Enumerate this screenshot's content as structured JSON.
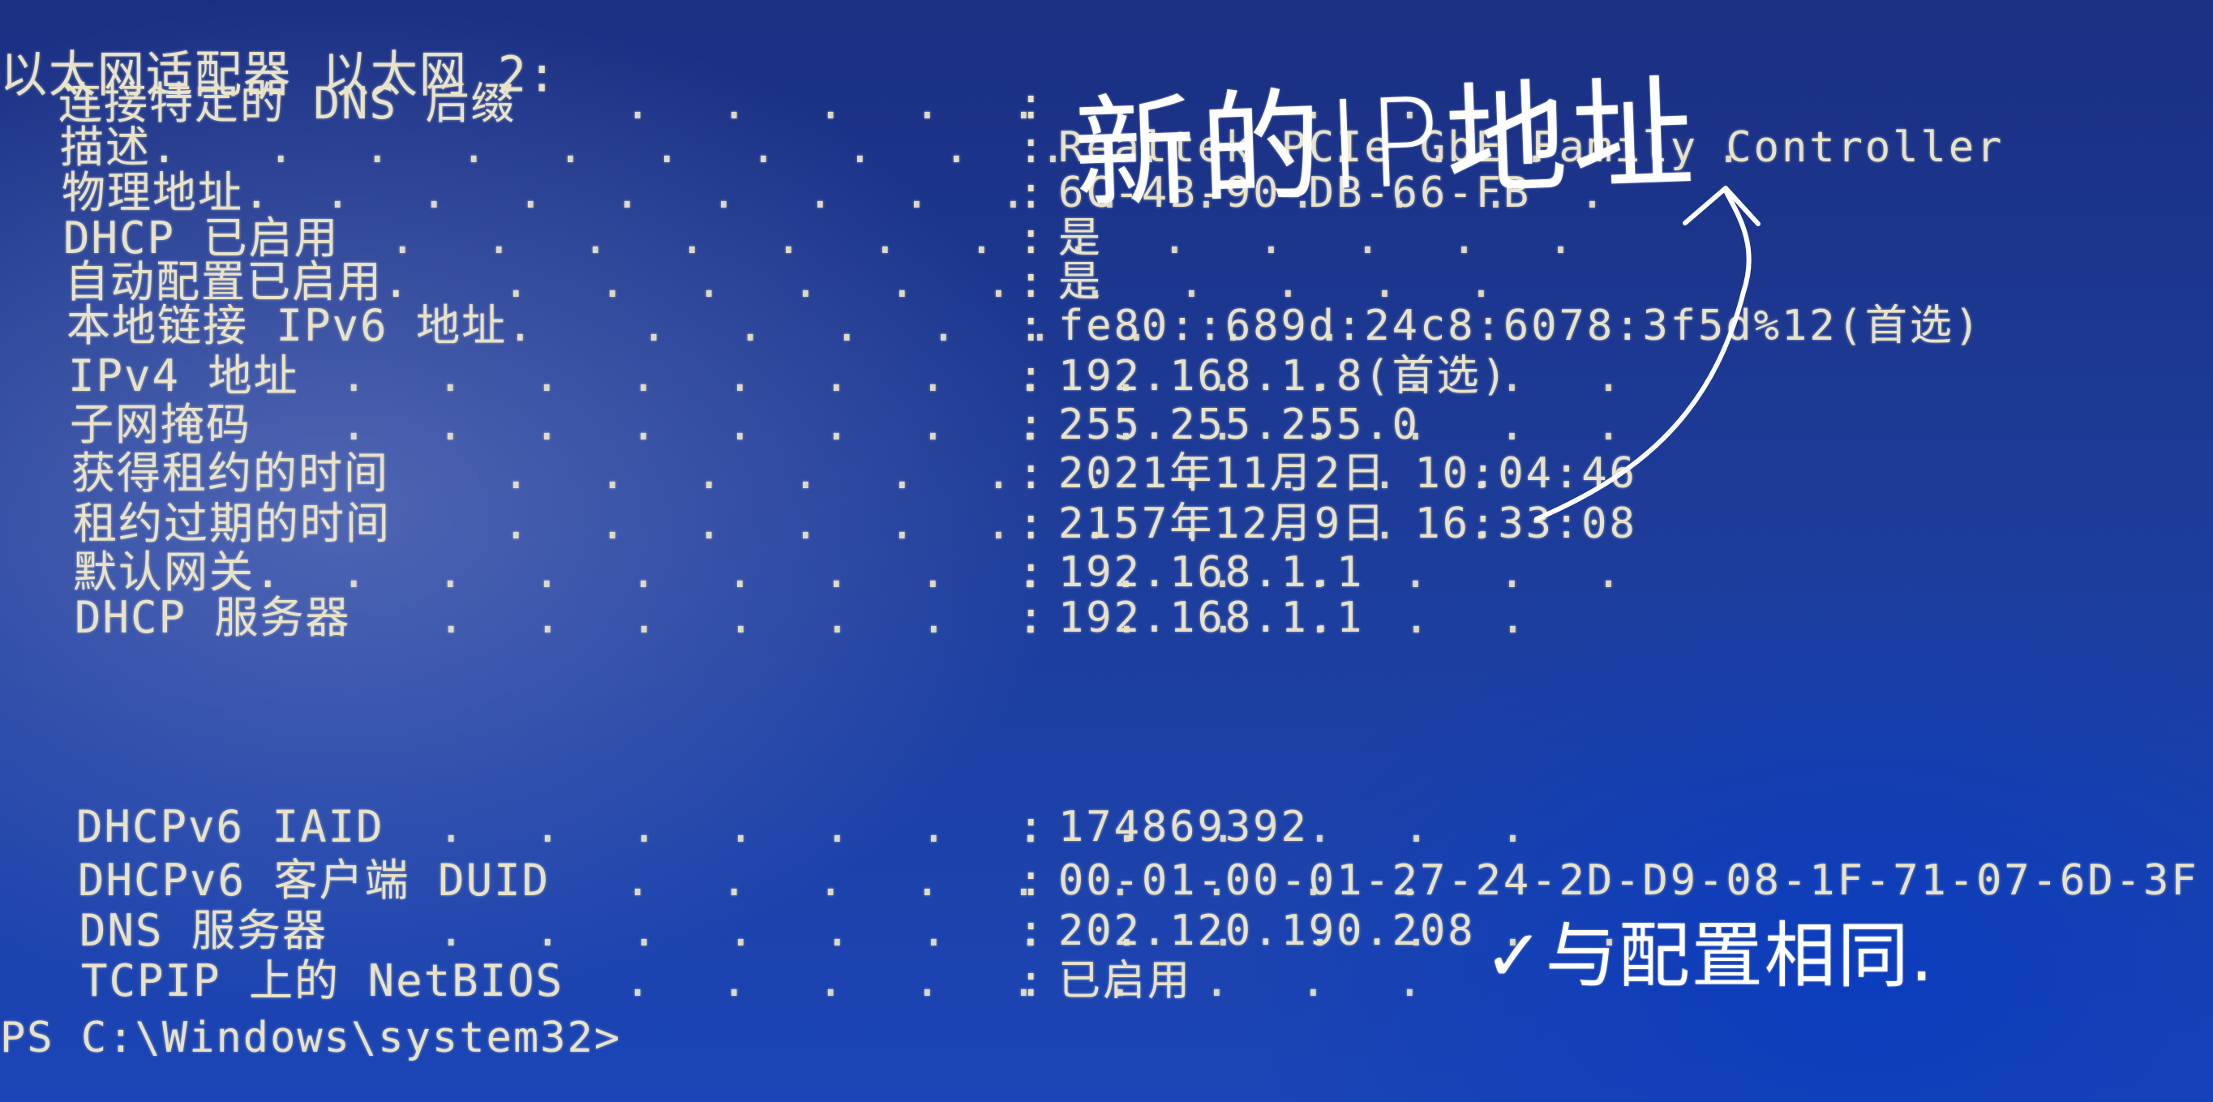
{
  "console": {
    "adapter_title": "以太网适配器 以太网 2:",
    "rows": [
      {
        "label": "连接特定的 DNS 后缀",
        "dots": ". . . . . . . . .",
        "value": ""
      },
      {
        "label": "描述.",
        "dots": ". . . . . . . . . . . . . . . .",
        "value": "Realtek PCIe GbE Family Controller"
      },
      {
        "label": "物理地址.",
        "dots": ". . . . . . . . . . . . . .",
        "value": "6C-4B-90-DB-66-FB"
      },
      {
        "label": "DHCP 已启用",
        "dots": ". . . . . . . . . . . . .",
        "value": "是"
      },
      {
        "label": "自动配置已启用.",
        "dots": ". . . . . . . . . . .",
        "value": "是"
      },
      {
        "label": "本地链接 IPv6 地址.",
        "dots": ". . . . . . . .",
        "value": "fe80::689d:24c8:6078:3f5d%12(首选)"
      },
      {
        "label": "IPv4 地址",
        "dots": ". . . . . . . . . . . . . .",
        "value": "192.168.1.8(首选)"
      },
      {
        "label": "子网掩码",
        "dots": ". . . . . . . . . . . . . .",
        "value": "255.255.255.0"
      },
      {
        "label": "获得租约的时间",
        "dots": ". . . . . . . . . . .",
        "value": "2021年11月2日 10:04:46"
      },
      {
        "label": "租约过期的时间",
        "dots": ". . . . . . . . . . .",
        "value": "2157年12月9日 16:33:08"
      },
      {
        "label": "默认网关.",
        "dots": ". . . . . . . . . . . . . .",
        "value": "192.168.1.1"
      },
      {
        "label": "DHCP 服务器",
        "dots": ". . . . . . . . . . . .",
        "value": "192.168.1.1"
      },
      {
        "label": "DHCPv6 IAID",
        "dots": ". . . . . . . . . . . .",
        "value": "174869392"
      },
      {
        "label": "DHCPv6 客户端 DUID",
        "dots": ". . . . . . . . .",
        "value": "00-01-00-01-27-24-2D-D9-08-1F-71-07-6D-3F"
      },
      {
        "label": "DNS 服务器",
        "dots": ". . . . . . . . . . . . .",
        "value": "202.120.190.208"
      },
      {
        "label": "TCPIP 上的 NetBIOS",
        "dots": ". . . . . . . . .",
        "value": "已启用"
      }
    ],
    "colon": ":",
    "prompt": "PS C:\\Windows\\system32>"
  },
  "annotations": {
    "new_ip_note": "新的IP地址",
    "same_config_note": "✓与配置相同."
  },
  "colors": {
    "console_text": "#e8e2c8",
    "background": "#1d3c98",
    "handwriting": "#ffffff"
  }
}
